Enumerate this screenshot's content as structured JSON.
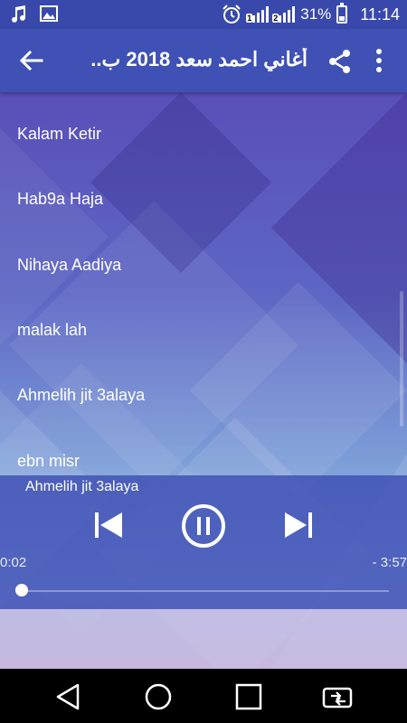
{
  "status_bar": {
    "battery_percent": "31%",
    "time": "11:14",
    "sim1_label": "1",
    "sim2_label": "2",
    "icons": [
      "music-note-icon",
      "image-icon",
      "alarm-icon",
      "signal-icon",
      "battery-icon"
    ]
  },
  "toolbar": {
    "title": "أغاني احمد سعد 2018 ب..",
    "back_icon": "arrow-left-icon",
    "share_icon": "share-icon",
    "more_icon": "more-vert-icon"
  },
  "songs": [
    {
      "title": "Kalam Ketir"
    },
    {
      "title": "Hab9a Haja"
    },
    {
      "title": "Nihaya Aadiya"
    },
    {
      "title": "malak lah"
    },
    {
      "title": "Ahmelih jit 3alaya"
    },
    {
      "title": "ebn misr"
    }
  ],
  "player": {
    "now_playing": "Ahmelih jit 3alaya",
    "current_time": "0:02",
    "remaining_time": "- 3:57",
    "progress_fraction": 0.01,
    "state": "playing"
  },
  "colors": {
    "accent": "#3f51b5",
    "status_bar": "#3949ab"
  }
}
